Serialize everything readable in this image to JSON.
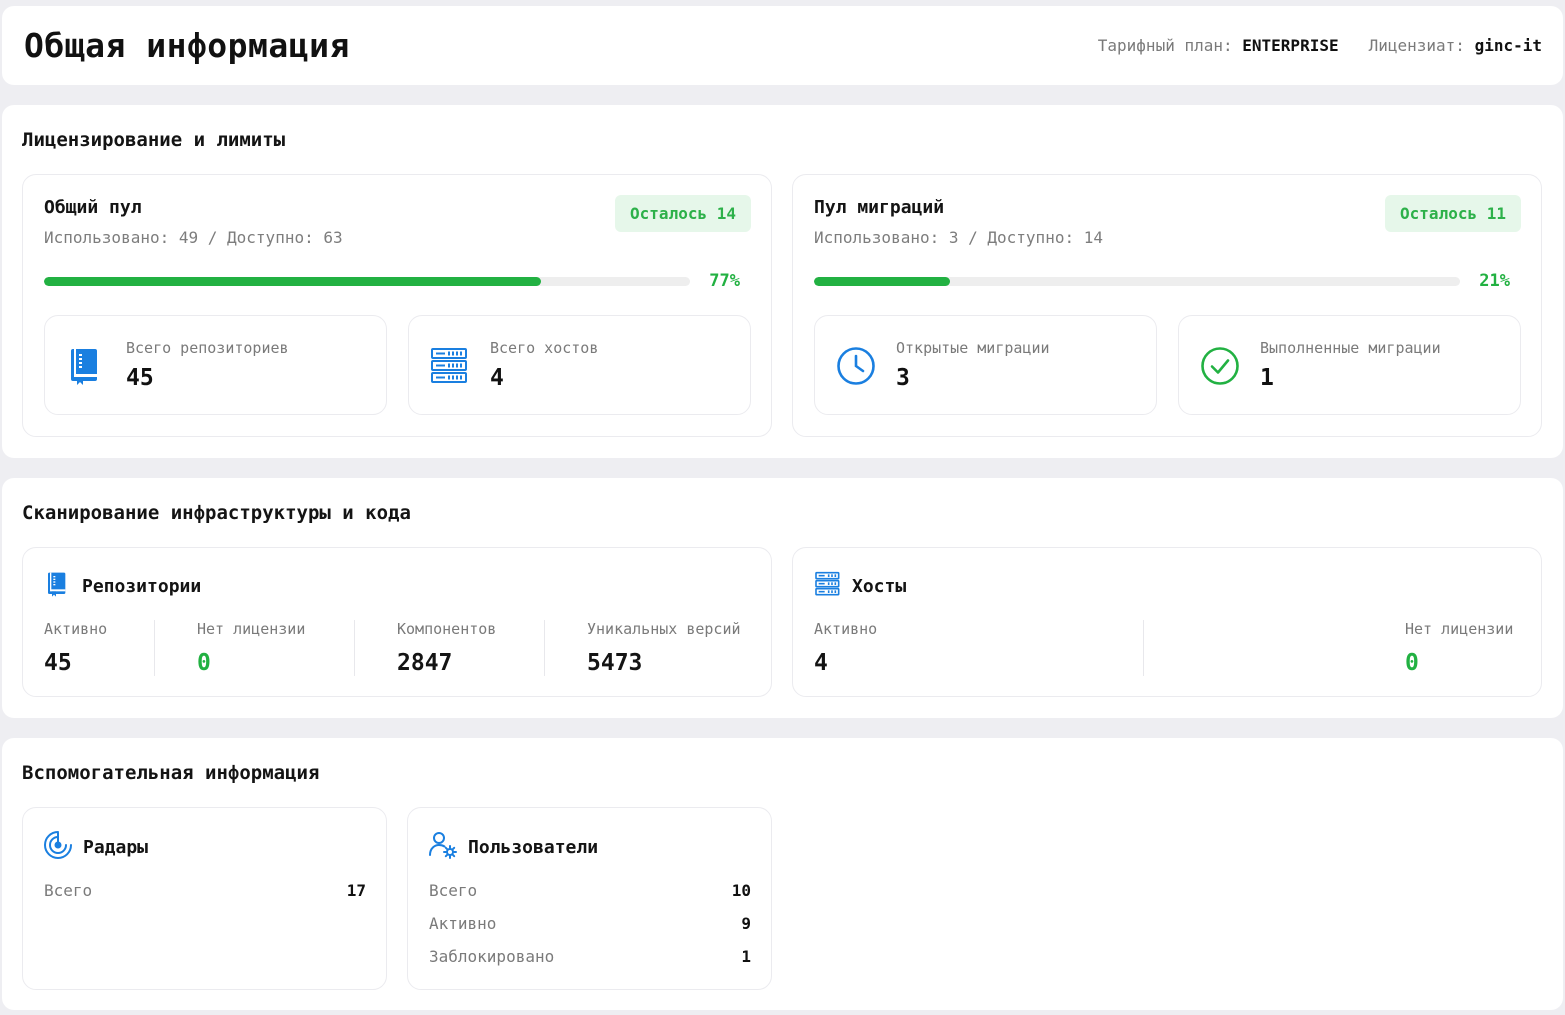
{
  "header": {
    "title": "Общая информация",
    "plan_label": "Тарифный план:",
    "plan_value": "ENTERPRISE",
    "licensee_label": "Лицензиат:",
    "licensee_value": "ginc-it"
  },
  "licensing": {
    "title": "Лицензирование и лимиты",
    "pools": [
      {
        "name": "Общий пул",
        "usage": "Использовано: 49 / Доступно: 63",
        "badge": "Осталось 14",
        "percent": 77,
        "percent_label": "77%",
        "stats": [
          {
            "icon": "repository-book-icon",
            "label": "Всего репозиториев",
            "value": "45"
          },
          {
            "icon": "server-stack-icon",
            "label": "Всего хостов",
            "value": "4"
          }
        ]
      },
      {
        "name": "Пул миграций",
        "usage": "Использовано: 3 / Доступно: 14",
        "badge": "Осталось 11",
        "percent": 21,
        "percent_label": "21%",
        "stats": [
          {
            "icon": "clock-icon",
            "label": "Открытые миграции",
            "value": "3"
          },
          {
            "icon": "check-circle-icon",
            "label": "Выполненные миграции",
            "value": "1"
          }
        ]
      }
    ]
  },
  "scanning": {
    "title": "Сканирование инфраструктуры и кода",
    "repositories": {
      "title": "Репозитории",
      "columns": [
        {
          "label": "Активно",
          "value": "45",
          "color": "#111111"
        },
        {
          "label": "Нет лицензии",
          "value": "0",
          "color": "#22b142"
        },
        {
          "label": "Компонентов",
          "value": "2847",
          "color": "#111111"
        },
        {
          "label": "Уникальных версий",
          "value": "5473",
          "color": "#111111"
        }
      ]
    },
    "hosts": {
      "title": "Хосты",
      "columns": [
        {
          "label": "Активно",
          "value": "4",
          "color": "#111111"
        },
        {
          "label": "Нет лицензии",
          "value": "0",
          "color": "#22b142"
        }
      ]
    }
  },
  "auxiliary": {
    "title": "Вспомогательная информация",
    "radars": {
      "title": "Радары",
      "rows": [
        {
          "label": "Всего",
          "value": "17"
        }
      ]
    },
    "users": {
      "title": "Пользователи",
      "rows": [
        {
          "label": "Всего",
          "value": "10"
        },
        {
          "label": "Активно",
          "value": "9"
        },
        {
          "label": "Заблокировано",
          "value": "1"
        }
      ]
    }
  },
  "colors": {
    "accent_blue": "#1a7fe0",
    "success_green": "#22b142",
    "badge_bg": "#e6f7ea"
  }
}
